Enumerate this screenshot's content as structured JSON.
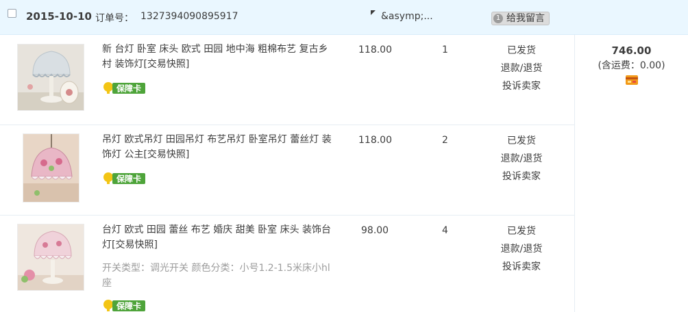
{
  "order": {
    "date": "2015-10-10",
    "order_label": "订单号：",
    "order_number": "1327394090895917",
    "shop_name": "&asymp;...",
    "message_button": "给我留言",
    "message_icon": "1"
  },
  "items": [
    {
      "title": "新 台灯 卧室 床头 欧式 田园 地中海 粗棉布艺 复古乡村 装饰灯[交易快照]",
      "sku": "",
      "badge": "保障卡",
      "price": "118.00",
      "quantity": "1",
      "status": "已发货",
      "refund": "退款/退货",
      "complain": "投诉卖家"
    },
    {
      "title": "吊灯 欧式吊灯 田园吊灯 布艺吊灯 卧室吊灯 蕾丝灯 装饰灯 公主[交易快照]",
      "sku": "",
      "badge": "保障卡",
      "price": "118.00",
      "quantity": "2",
      "status": "已发货",
      "refund": "退款/退货",
      "complain": "投诉卖家"
    },
    {
      "title": "台灯 欧式 田园 蕾丝 布艺 婚庆 甜美 卧室 床头 装饰台灯[交易快照]",
      "sku": "开关类型：调光开关  颜色分类：小号1.2-1.5米床小hl座",
      "badge": "保障卡",
      "price": "98.00",
      "quantity": "4",
      "status": "已发货",
      "refund": "退款/退货",
      "complain": "投诉卖家"
    }
  ],
  "total": {
    "amount": "746.00",
    "shipping_text": "(含运费：0.00)",
    "card_icon": "credit-card-icon"
  },
  "colors": {
    "header_bg": "#eaf7ff",
    "badge_green": "#4ea43a",
    "badge_yellow": "#f3c515"
  },
  "icons": [
    "checkbox-icon",
    "flag-icon",
    "message-icon",
    "guarantee-badge-icon",
    "credit-card-icon"
  ]
}
